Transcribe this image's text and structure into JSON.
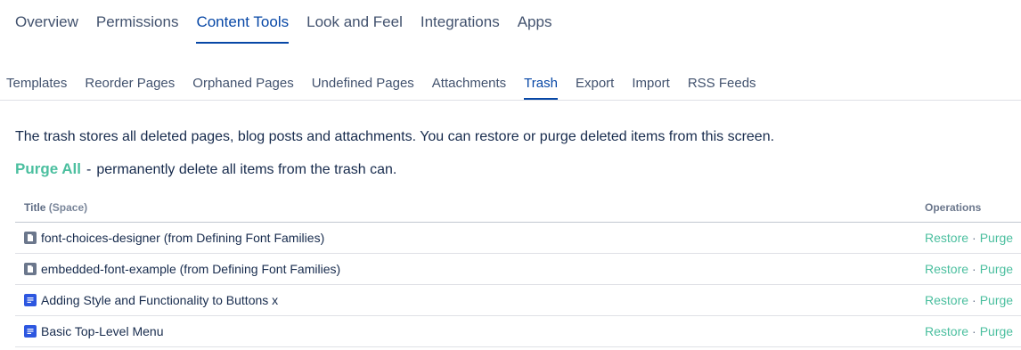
{
  "top_tabs": [
    {
      "label": "Overview",
      "active": false
    },
    {
      "label": "Permissions",
      "active": false
    },
    {
      "label": "Content Tools",
      "active": true
    },
    {
      "label": "Look and Feel",
      "active": false
    },
    {
      "label": "Integrations",
      "active": false
    },
    {
      "label": "Apps",
      "active": false
    }
  ],
  "sub_tabs": [
    {
      "label": "Templates",
      "active": false
    },
    {
      "label": "Reorder Pages",
      "active": false
    },
    {
      "label": "Orphaned Pages",
      "active": false
    },
    {
      "label": "Undefined Pages",
      "active": false
    },
    {
      "label": "Attachments",
      "active": false
    },
    {
      "label": "Trash",
      "active": true
    },
    {
      "label": "Export",
      "active": false
    },
    {
      "label": "Import",
      "active": false
    },
    {
      "label": "RSS Feeds",
      "active": false
    }
  ],
  "description": "The trash stores all deleted pages, blog posts and attachments. You can restore or purge deleted items from this screen.",
  "purge_all": {
    "label": "Purge All",
    "separator": "-",
    "text": "permanently delete all items from the trash can."
  },
  "table": {
    "header_title": "Title",
    "header_space": "(Space)",
    "header_operations": "Operations",
    "rows": [
      {
        "title": "font-choices-designer (from Defining Font Families)",
        "icon": "attachment-file-icon",
        "restore": "Restore",
        "sep": "·",
        "purge": "Purge"
      },
      {
        "title": "embedded-font-example (from Defining Font Families)",
        "icon": "attachment-file-icon",
        "restore": "Restore",
        "sep": "·",
        "purge": "Purge"
      },
      {
        "title": "Adding Style and Functionality to Buttons x",
        "icon": "page-icon",
        "restore": "Restore",
        "sep": "·",
        "purge": "Purge"
      },
      {
        "title": "Basic Top-Level Menu",
        "icon": "page-icon",
        "restore": "Restore",
        "sep": "·",
        "purge": "Purge"
      }
    ]
  },
  "colors": {
    "active_tab": "#0747a6",
    "link_green": "#4bbf9f",
    "page_icon_blue": "#2d57e0",
    "file_icon_grey": "#6b778c"
  }
}
